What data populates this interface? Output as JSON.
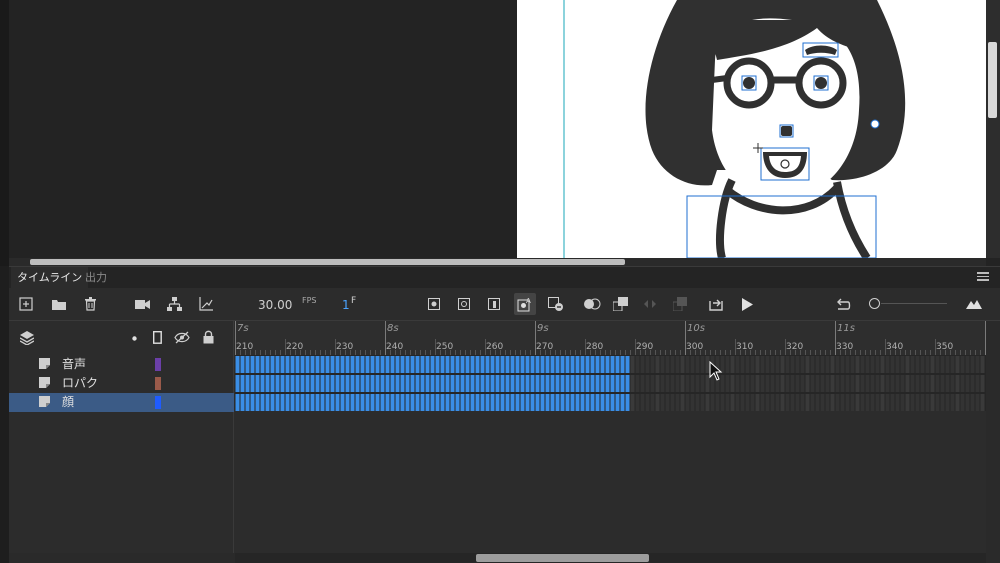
{
  "panel": {
    "tab_timeline": "タイムライン",
    "tab_output": "出力"
  },
  "toolbar": {
    "fps_value": "30.00",
    "fps_unit": "FPS",
    "frame_value": "1",
    "frame_unit": "F"
  },
  "layers": [
    {
      "name": "音声",
      "color": "#6b3fa8",
      "selected": false
    },
    {
      "name": "ロパク",
      "color": "#9a5a4a",
      "selected": false
    },
    {
      "name": "顔",
      "color": "#1f5cff",
      "selected": true
    }
  ],
  "ruler": {
    "seconds": [
      "7s",
      "8s",
      "9s",
      "10s",
      "11s"
    ],
    "frames": [
      "210",
      "220",
      "230",
      "240",
      "250",
      "260",
      "270",
      "280",
      "290",
      "300",
      "310",
      "320",
      "330",
      "340",
      "350"
    ]
  },
  "timeline": {
    "first_frame": 210,
    "filled_until": 289,
    "last_visible_frame": 359,
    "filled_color": "#3a8ee6",
    "empty_color": "#333333"
  },
  "icons": {
    "new_layer": "new-layer-icon",
    "new_folder": "new-folder-icon",
    "delete": "trash-icon",
    "camera": "camera-icon",
    "layer_parenting": "hierarchy-icon",
    "graph": "graph-icon",
    "layers": "layers-icon",
    "eye": "eye-icon",
    "lock": "lock-icon",
    "play": "play-icon",
    "loop": "loop-icon"
  }
}
